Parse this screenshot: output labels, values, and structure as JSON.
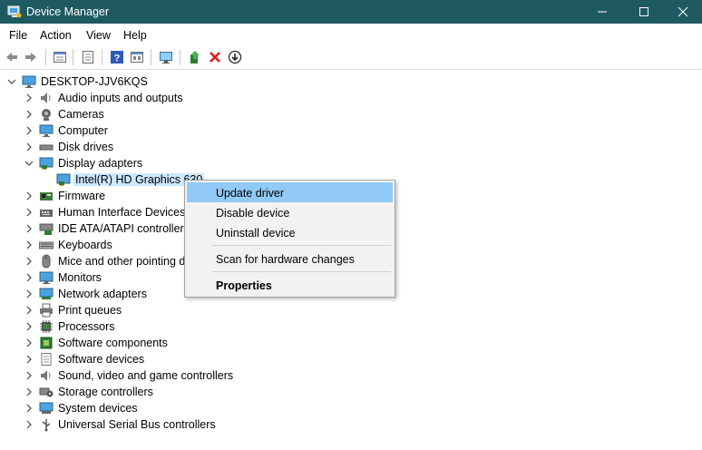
{
  "window": {
    "title": "Device Manager",
    "titlebar_color": "#1f5a63"
  },
  "menu": [
    "File",
    "Action",
    "View",
    "Help"
  ],
  "toolbar": {
    "icons": [
      "back-arrow-icon",
      "forward-arrow-icon",
      "properties-icon",
      "list-icon",
      "help-icon",
      "show-hidden-icon",
      "monitor-scan-icon",
      "add-driver-icon",
      "remove-device-icon",
      "update-driver-icon"
    ]
  },
  "tree": {
    "root": "DESKTOP-JJV6KQS",
    "categories": [
      {
        "label": "Audio inputs and outputs",
        "icon": "speaker-icon"
      },
      {
        "label": "Cameras",
        "icon": "camera-icon"
      },
      {
        "label": "Computer",
        "icon": "computer-icon"
      },
      {
        "label": "Disk drives",
        "icon": "disk-drive-icon"
      },
      {
        "label": "Display adapters",
        "icon": "display-adapter-icon",
        "expanded": true,
        "children": [
          {
            "label": "Intel(R) HD Graphics 630",
            "icon": "display-adapter-icon",
            "selected": true
          }
        ]
      },
      {
        "label": "Firmware",
        "icon": "firmware-icon"
      },
      {
        "label": "Human Interface Devices",
        "icon": "hid-icon"
      },
      {
        "label": "IDE ATA/ATAPI controllers",
        "icon": "ide-controller-icon"
      },
      {
        "label": "Keyboards",
        "icon": "keyboard-icon"
      },
      {
        "label": "Mice and other pointing devices",
        "icon": "mouse-icon"
      },
      {
        "label": "Monitors",
        "icon": "monitor-icon"
      },
      {
        "label": "Network adapters",
        "icon": "network-adapter-icon"
      },
      {
        "label": "Print queues",
        "icon": "printer-icon"
      },
      {
        "label": "Processors",
        "icon": "processor-icon"
      },
      {
        "label": "Software components",
        "icon": "software-component-icon"
      },
      {
        "label": "Software devices",
        "icon": "software-device-icon"
      },
      {
        "label": "Sound, video and game controllers",
        "icon": "sound-controller-icon"
      },
      {
        "label": "Storage controllers",
        "icon": "storage-controller-icon"
      },
      {
        "label": "System devices",
        "icon": "system-device-icon"
      },
      {
        "label": "Universal Serial Bus controllers",
        "icon": "usb-icon"
      }
    ]
  },
  "context_menu": {
    "items": [
      {
        "label": "Update driver",
        "highlighted": true
      },
      {
        "label": "Disable device"
      },
      {
        "label": "Uninstall device"
      },
      {
        "label": "Scan for hardware changes"
      },
      {
        "label": "Properties",
        "bold": true
      }
    ]
  }
}
